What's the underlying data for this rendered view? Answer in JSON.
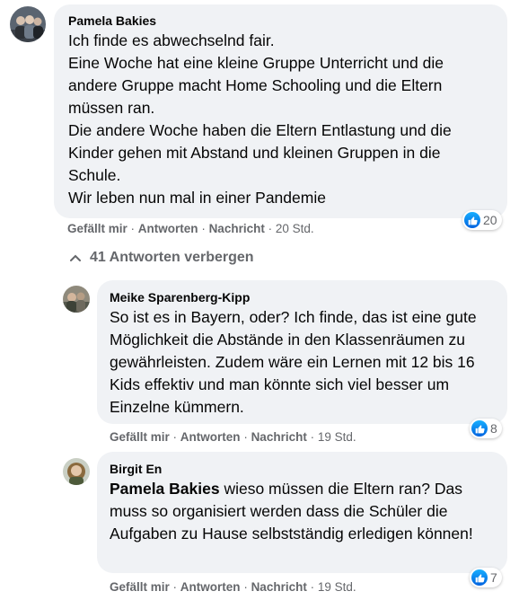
{
  "comments": [
    {
      "author": "Pamela Bakies",
      "lines": [
        "Ich finde es abwechselnd fair.",
        "Eine Woche hat eine kleine Gruppe Unterricht und die andere Gruppe macht Home Schooling und die Eltern müssen ran.",
        "Die andere Woche haben die Eltern Entlastung und die Kinder gehen mit Abstand und kleinen Gruppen in die Schule.",
        "Wir leben nun mal in einer Pandemie"
      ],
      "like_label": "Gefällt mir",
      "reply_label": "Antworten",
      "message_label": "Nachricht",
      "time": "20 Std.",
      "reactions": "20"
    }
  ],
  "replies_toggle": "41 Antworten verbergen",
  "replies": [
    {
      "author": "Meike Sparenberg-Kipp",
      "text": "So ist es in Bayern, oder? Ich finde, das ist eine gute Möglichkeit die Abstände in den Klassenräumen zu gewährleisten. Zudem wäre ein Lernen mit 12 bis 16 Kids effektiv und man könnte sich viel besser um Einzelne kümmern.",
      "like_label": "Gefällt mir",
      "reply_label": "Antworten",
      "message_label": "Nachricht",
      "time": "19 Std.",
      "reactions": "8"
    },
    {
      "author": "Birgit En",
      "mention": "Pamela Bakies",
      "text": " wieso müssen die Eltern ran? Das muss so organisiert werden dass die Schüler die Aufgaben zu Hause selbstständig erledigen können!",
      "like_label": "Gefällt mir",
      "reply_label": "Antworten",
      "message_label": "Nachricht",
      "time": "19 Std.",
      "reactions": "7"
    }
  ],
  "colors": {
    "bubble": "#f0f2f5",
    "meta": "#65676b",
    "like_blue": "#1877f2"
  }
}
